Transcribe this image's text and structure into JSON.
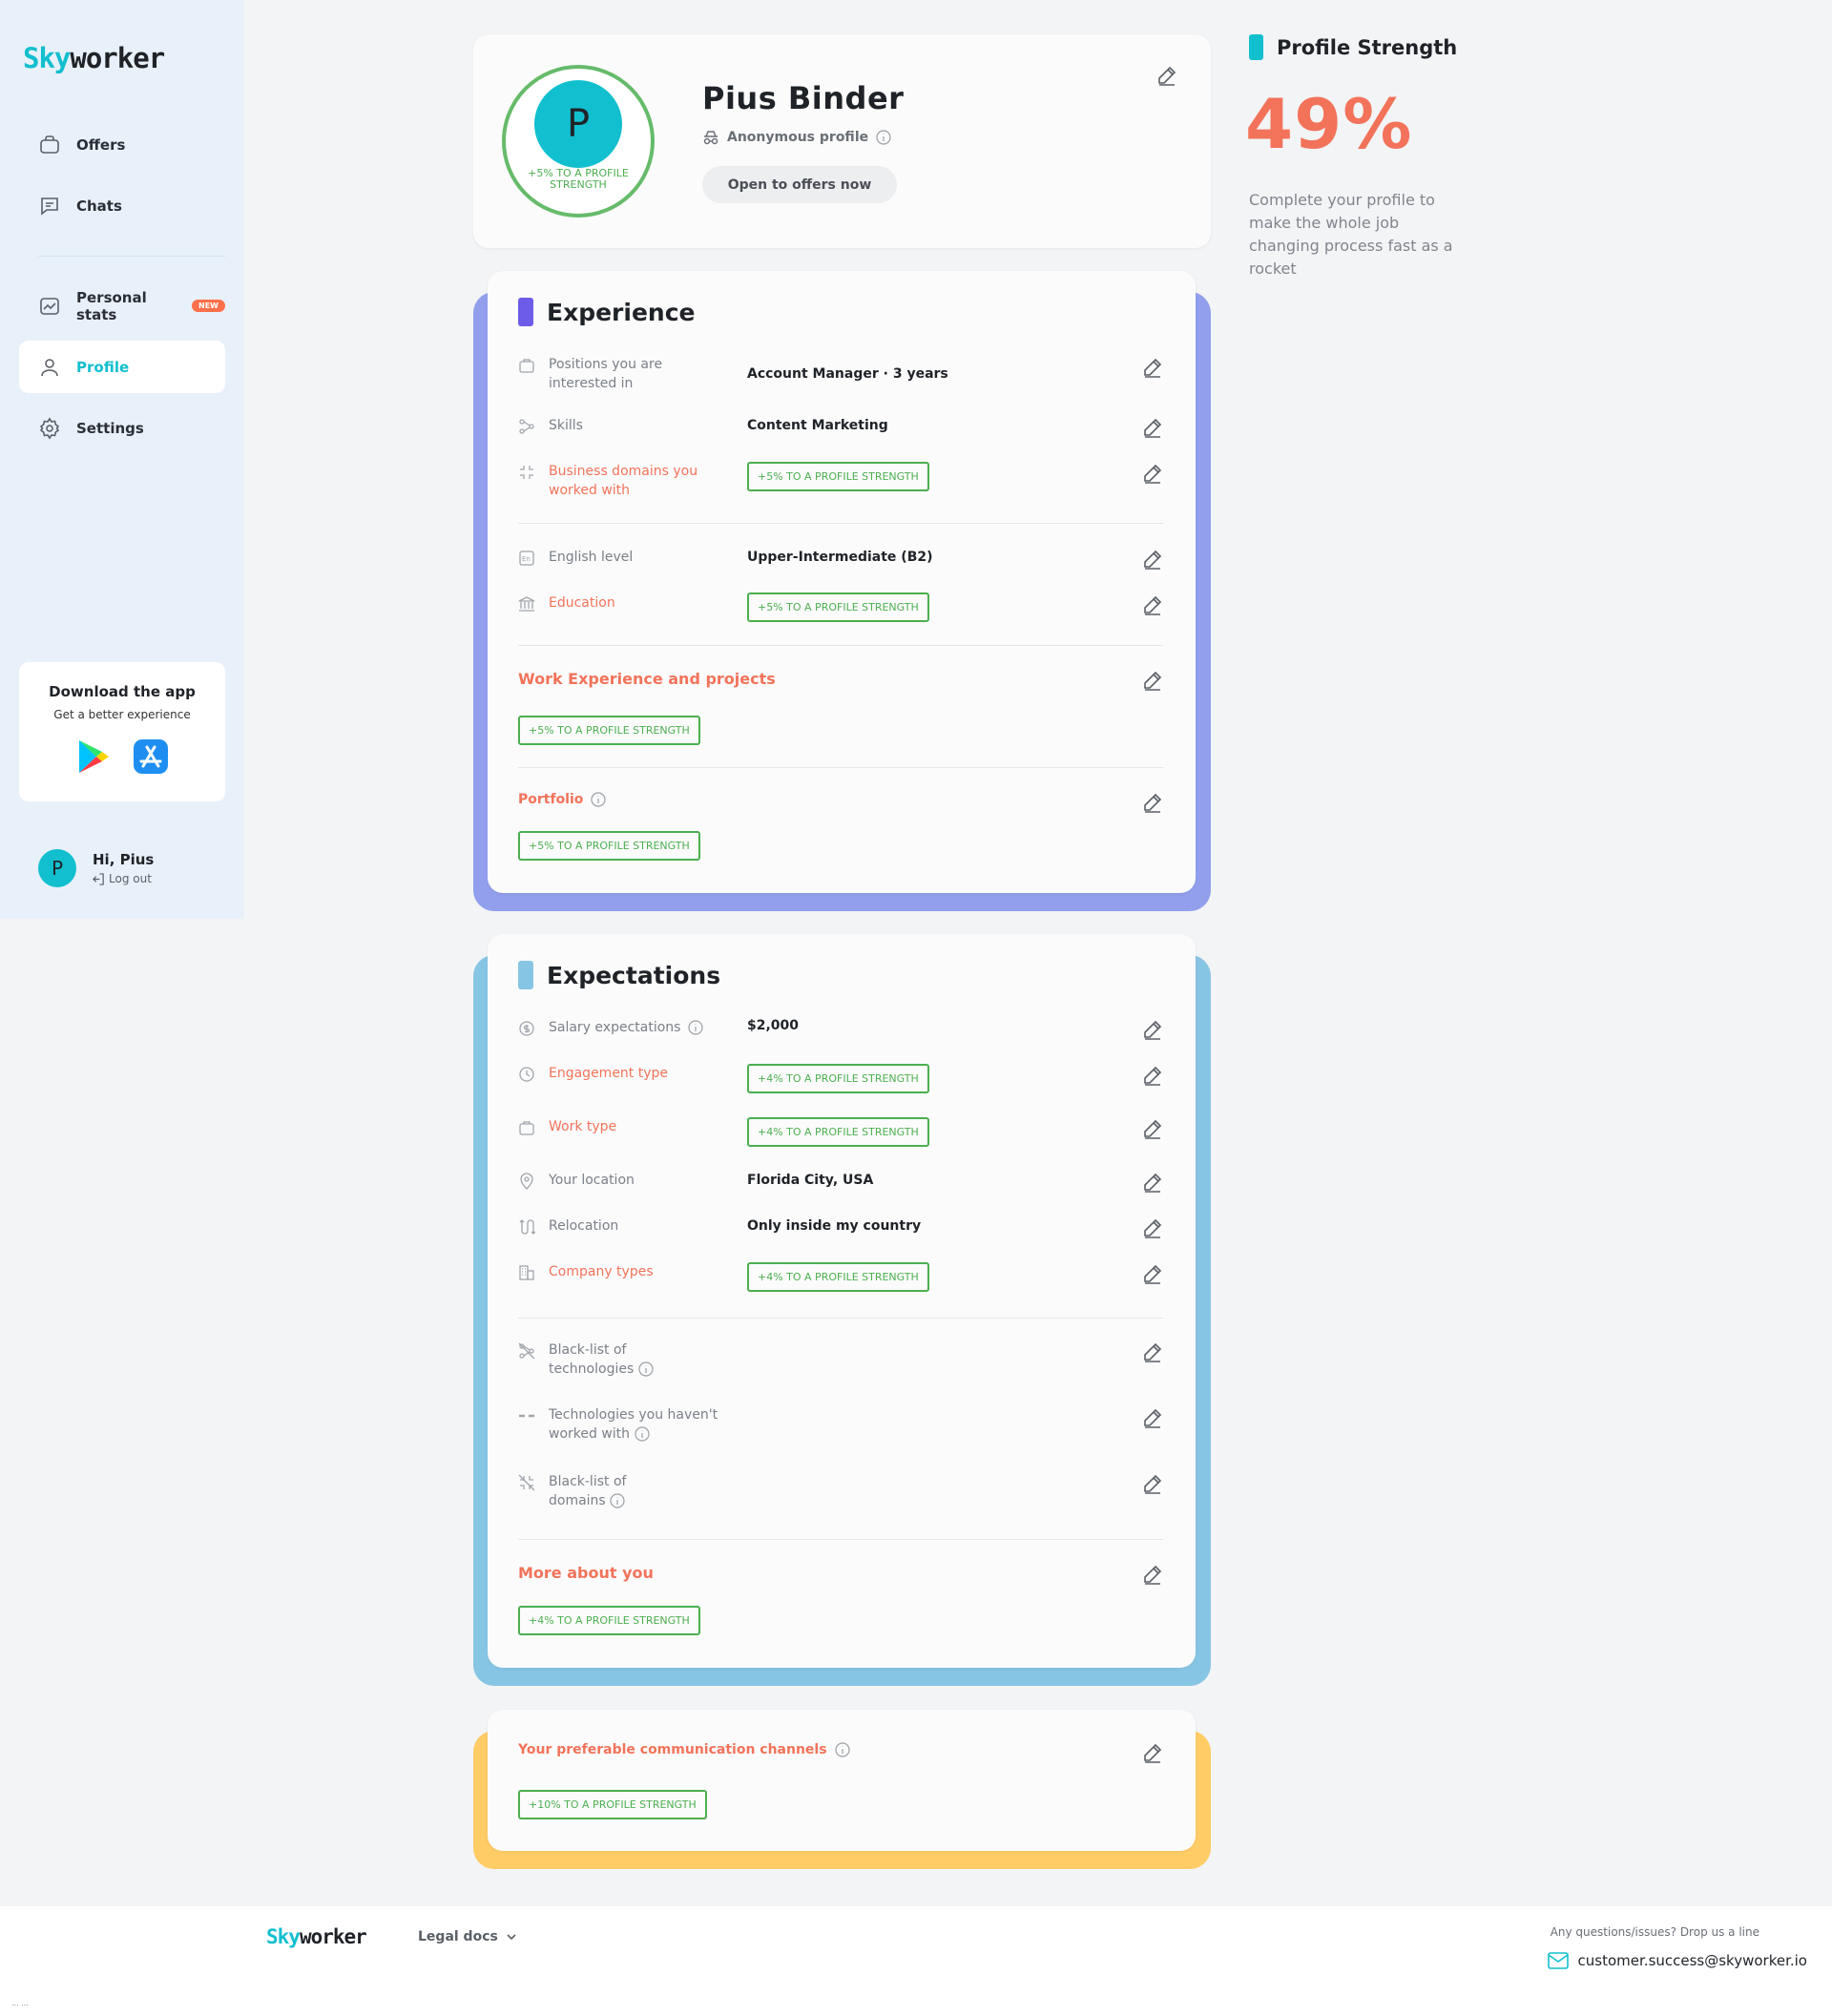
{
  "brand": {
    "sky": "Sky",
    "worker": "worker"
  },
  "sidebar": {
    "items": [
      {
        "label": "Offers"
      },
      {
        "label": "Chats"
      },
      {
        "label": "Personal stats",
        "badge": "NEW"
      },
      {
        "label": "Profile"
      },
      {
        "label": "Settings"
      }
    ],
    "app": {
      "title": "Download the app",
      "subtitle": "Get a better experience"
    },
    "user": {
      "greeting": "Hi, Pius",
      "logout": "Log out",
      "initial": "P"
    }
  },
  "profile": {
    "initial": "P",
    "ring_label": "+5% TO A PROFILE STRENGTH",
    "name": "Pius Binder",
    "anonymous": "Anonymous profile",
    "open_button": "Open to offers now"
  },
  "experience": {
    "title": "Experience",
    "positions_label": "Positions you are interested in",
    "positions_value": "Account Manager · 3 years",
    "skills_label": "Skills",
    "skills_value": "Content Marketing",
    "domains_label": "Business domains you worked with",
    "domains_chip": "+5% TO A PROFILE STRENGTH",
    "english_label": "English level",
    "english_value": "Upper-Intermediate (B2)",
    "education_label": "Education",
    "education_chip": "+5% TO A PROFILE STRENGTH",
    "work_head": "Work Experience and projects",
    "work_chip": "+5% TO A PROFILE STRENGTH",
    "portfolio_head": "Portfolio",
    "portfolio_chip": "+5% TO A PROFILE STRENGTH"
  },
  "expectations": {
    "title": "Expectations",
    "salary_label": "Salary expectations",
    "salary_value": "$2,000",
    "engagement_label": "Engagement type",
    "engagement_chip": "+4% TO A PROFILE STRENGTH",
    "worktype_label": "Work type",
    "worktype_chip": "+4% TO A PROFILE STRENGTH",
    "location_label": "Your location",
    "location_value": "Florida City, USA",
    "relocation_label": "Relocation",
    "relocation_value": "Only inside my country",
    "company_label": "Company types",
    "company_chip": "+4% TO A PROFILE STRENGTH",
    "blacklist_tech_label": "Black-list of technologies",
    "not_worked_label": "Technologies you haven't worked with",
    "blacklist_domains_label": "Black-list of domains",
    "more_head": "More about you",
    "more_chip": "+4% TO A PROFILE STRENGTH"
  },
  "communication": {
    "head": "Your preferable communication channels",
    "chip": "+10% TO A PROFILE STRENGTH"
  },
  "strength": {
    "title": "Profile Strength",
    "value": "49%",
    "description": "Complete your profile to make the whole job changing process fast as a rocket"
  },
  "footer": {
    "legal": "Legal docs",
    "questions": "Any questions/issues? Drop us a line",
    "email": "customer.success@skyworker.io",
    "dots": "... ..."
  },
  "colors": {
    "accent": "#12bfcf",
    "orange": "#f2735a",
    "green": "#4caf50",
    "purple_frame": "#919fec",
    "blue_frame": "#87c5e4",
    "yellow_frame": "#ffcc66"
  }
}
